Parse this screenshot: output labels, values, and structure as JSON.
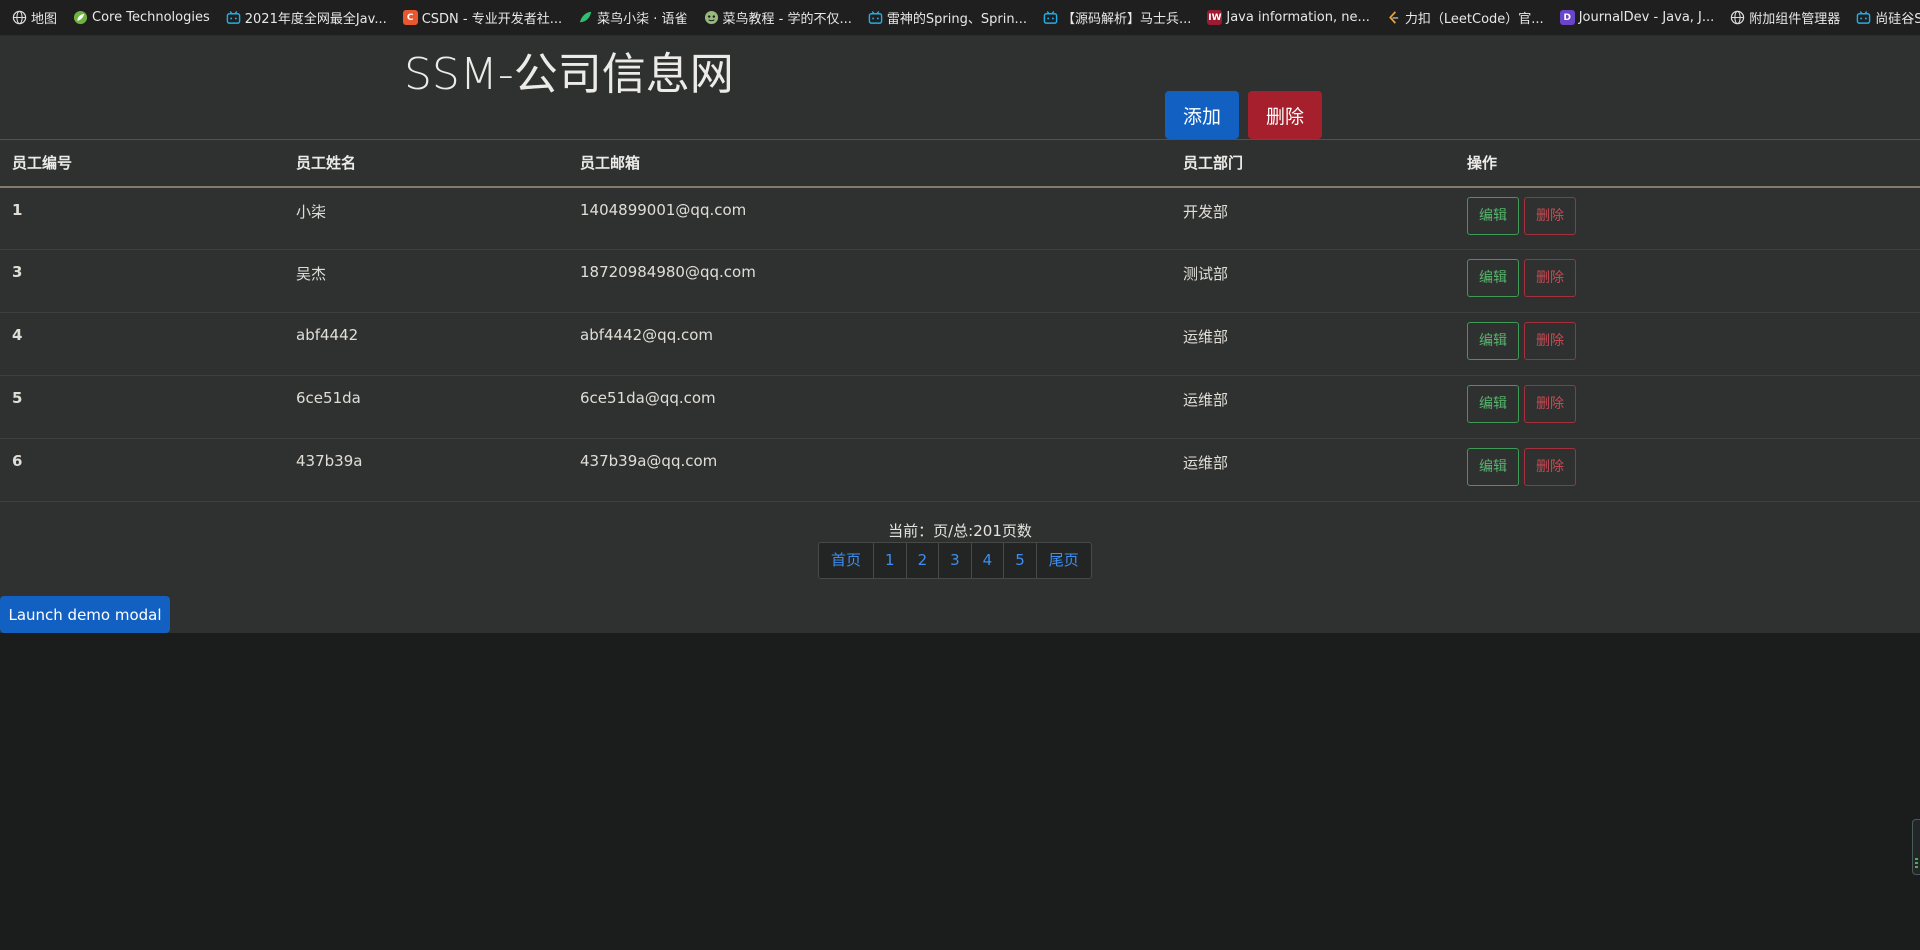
{
  "bookmarks": [
    {
      "label": "地图",
      "icon": "globe-icon"
    },
    {
      "label": "Core Technologies",
      "icon": "spring-leaf-icon"
    },
    {
      "label": "2021年度全网最全Jav...",
      "icon": "bilibili-icon"
    },
    {
      "label": "CSDN - 专业开发者社...",
      "icon": "csdn-icon",
      "icon_text": "C"
    },
    {
      "label": "菜鸟小柒 · 语雀",
      "icon": "yuque-icon"
    },
    {
      "label": "菜鸟教程 - 学的不仅...",
      "icon": "runoob-icon"
    },
    {
      "label": "雷神的Spring、Sprin...",
      "icon": "bilibili-icon"
    },
    {
      "label": "【源码解析】马士兵...",
      "icon": "bilibili-icon"
    },
    {
      "label": "Java information, ne...",
      "icon": "infoworld-icon",
      "icon_text": "IW"
    },
    {
      "label": "力扣（LeetCode）官...",
      "icon": "leetcode-icon"
    },
    {
      "label": "JournalDev - Java, J...",
      "icon": "journaldev-icon",
      "icon_text": "D"
    },
    {
      "label": "附加组件管理器",
      "icon": "globe-icon"
    },
    {
      "label": "尚硅谷SSM框架实战...",
      "icon": "bilibili-icon"
    }
  ],
  "header": {
    "title": "SSM-公司信息网",
    "add_label": "添加",
    "delete_label": "删除"
  },
  "table": {
    "columns": [
      "员工编号",
      "员工姓名",
      "员工邮箱",
      "员工部门",
      "操作"
    ],
    "edit_label": "编辑",
    "remove_label": "删除",
    "rows": [
      {
        "id": "1",
        "name": "小柒",
        "email": "1404899001@qq.com",
        "dept": "开发部"
      },
      {
        "id": "3",
        "name": "吴杰",
        "email": "18720984980@qq.com",
        "dept": "测试部"
      },
      {
        "id": "4",
        "name": "abf4442",
        "email": "abf4442@qq.com",
        "dept": "运维部"
      },
      {
        "id": "5",
        "name": "6ce51da",
        "email": "6ce51da@qq.com",
        "dept": "运维部"
      },
      {
        "id": "6",
        "name": "437b39a",
        "email": "437b39a@qq.com",
        "dept": "运维部"
      }
    ]
  },
  "pagination": {
    "info": "当前：页/总:201页数",
    "first": "首页",
    "pages": [
      "1",
      "2",
      "3",
      "4",
      "5"
    ],
    "last": "尾页"
  },
  "modal": {
    "launch_label": "Launch demo modal"
  },
  "colors": {
    "primary": "#1261c2",
    "danger": "#a51f2d",
    "success_outline": "#3f9a56",
    "danger_outline": "#a3303a",
    "link": "#3d8ef0",
    "panel_bg": "#2f3131",
    "page_bg": "#1b1d1d"
  }
}
